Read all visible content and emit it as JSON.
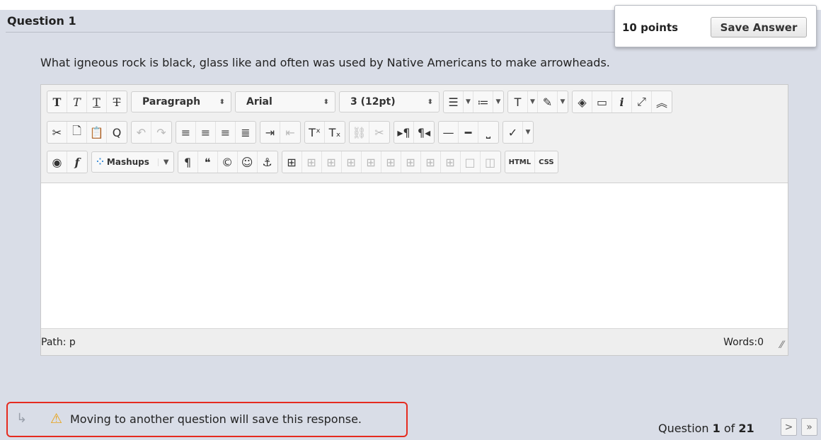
{
  "header_snippet": "Clipped text at top edge",
  "question": {
    "title": "Question 1",
    "points": "10 points",
    "save_label": "Save Answer",
    "text": "What igneous rock is black, glass like and often was used by Native Americans to make arrowheads."
  },
  "toolbar": {
    "paragraph_value": "Paragraph",
    "font_value": "Arial",
    "size_value": "3 (12pt)",
    "mashups_label": "Mashups",
    "html_label": "HTML",
    "css_label": "CSS",
    "icons_row1": [
      "bold-icon",
      "italic-icon",
      "underline-icon",
      "strikethrough-icon"
    ],
    "icons_row2": [
      "cut-icon",
      "copy-icon",
      "paste-icon",
      "find-icon",
      "undo-icon",
      "redo-icon"
    ]
  },
  "editor": {
    "path_label": "Path: p",
    "word_count": "Words:0"
  },
  "footer": {
    "save_note": "Moving to another question will save this response.",
    "question_prefix": "Question ",
    "question_current": "1",
    "question_of": " of ",
    "question_total": "21"
  },
  "colors": {
    "background": "#d9dde7",
    "highlight_border": "#e52b1f",
    "warning": "#e8a317"
  }
}
